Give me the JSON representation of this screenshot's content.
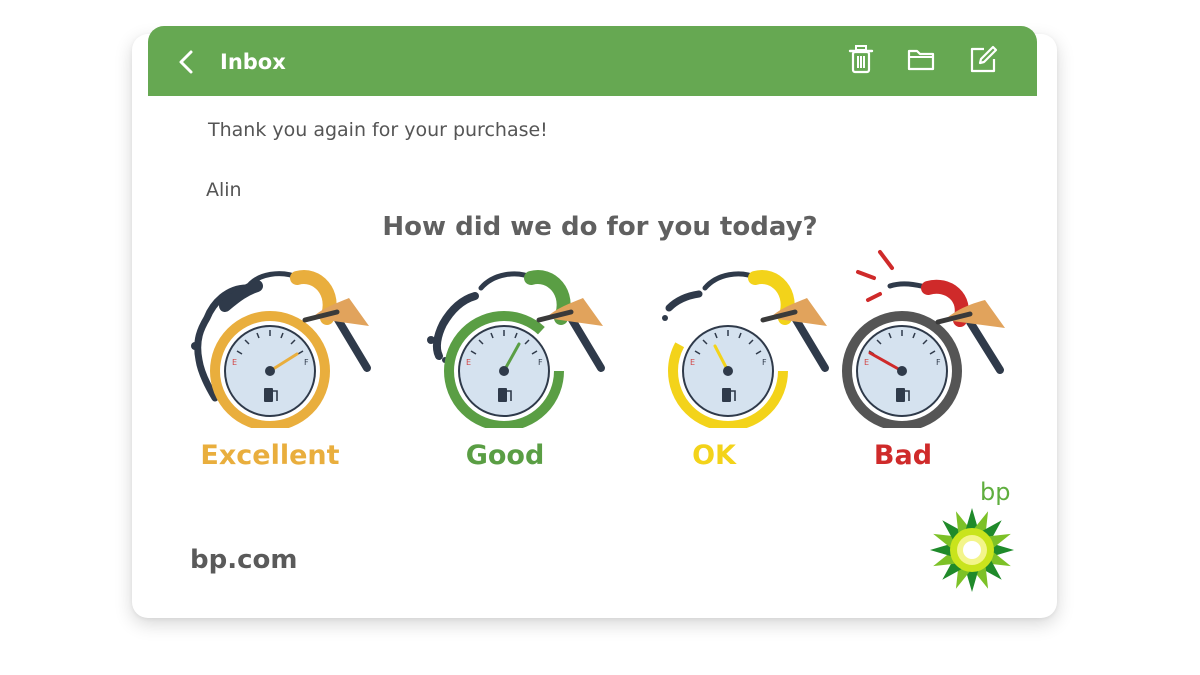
{
  "header": {
    "title": "Inbox",
    "icons": [
      "back-chevron-icon",
      "trash-icon",
      "folder-icon",
      "compose-icon"
    ],
    "background_color": "#66a852"
  },
  "email": {
    "thank_you": "Thank you again for your purchase!",
    "signature": "Alin",
    "question": "How did we do for you today?",
    "ratings": [
      {
        "label": "Excellent",
        "color": "#e9ae3d",
        "needle_level": "full"
      },
      {
        "label": "Good",
        "color": "#5a9e44",
        "needle_level": "three-quarter"
      },
      {
        "label": "OK",
        "color": "#f3d31a",
        "needle_level": "half"
      },
      {
        "label": "Bad",
        "color": "#cf2a2a",
        "needle_level": "empty"
      }
    ],
    "footer_url": "bp.com",
    "brand_text": "bp"
  }
}
